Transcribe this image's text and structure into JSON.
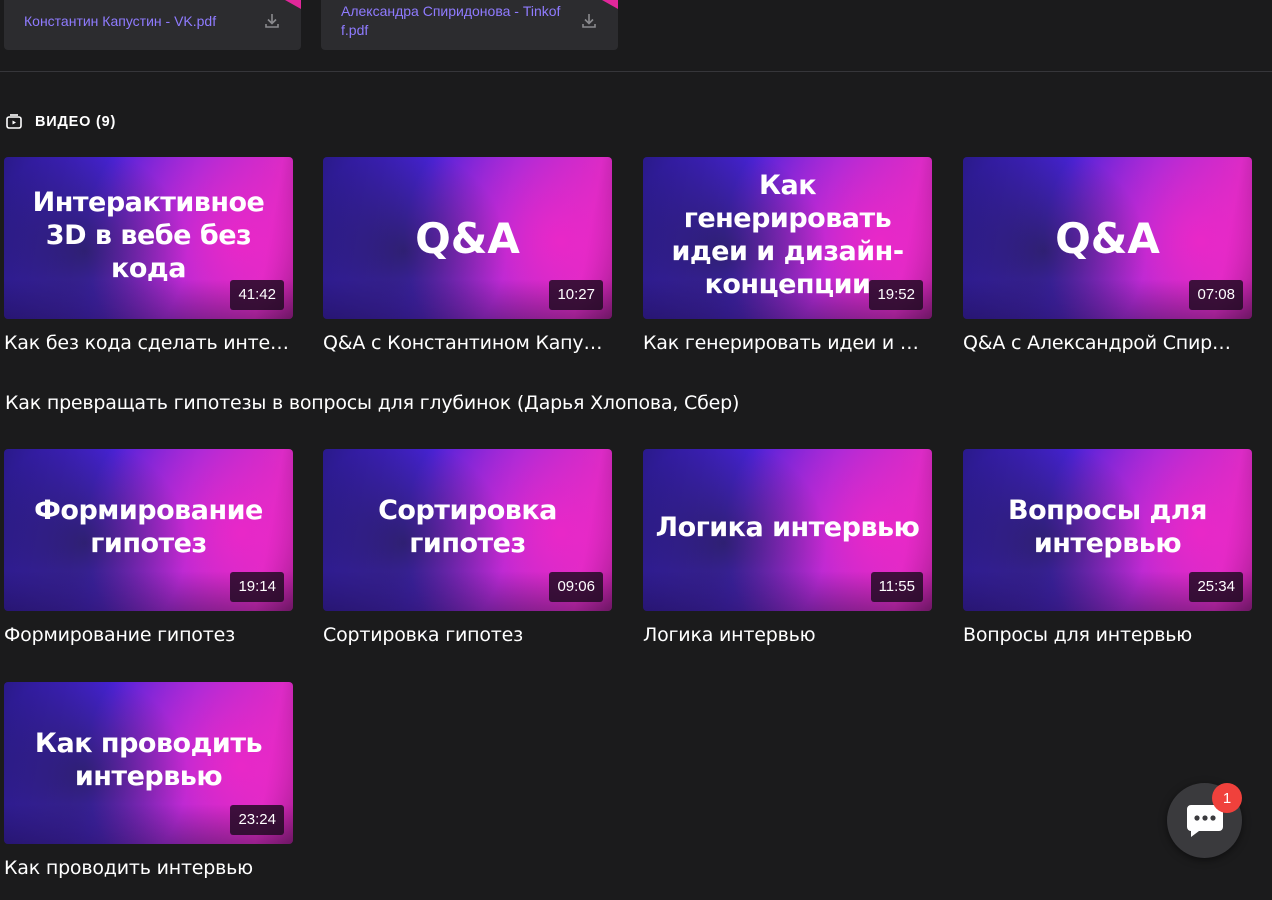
{
  "files": [
    {
      "name": "Константин Капустин - VK.pdf",
      "icon": "download-icon"
    },
    {
      "name": "Александра Спиридонова - Tinkoff.pdf",
      "icon": "download-icon"
    }
  ],
  "section": {
    "title": "ВИДЕО (9)",
    "icon": "video-icon"
  },
  "videos": [
    {
      "thumb": "Интерактивное 3D в вебе без кода",
      "duration": "41:42",
      "title": "Как без кода сделать инте…"
    },
    {
      "thumb": "Q&A",
      "duration": "10:27",
      "title": "Q&A с Константином Капу…"
    },
    {
      "thumb": "Как генерировать идеи и дизайн-концепции",
      "duration": "19:52",
      "title": "Как генерировать идеи и …"
    },
    {
      "thumb": "Q&A",
      "duration": "07:08",
      "title": "Q&A с Александрой Спир…"
    },
    {
      "thumb": "Формирование гипотез",
      "duration": "19:14",
      "title": "Формирование гипотез"
    },
    {
      "thumb": "Сортировка гипотез",
      "duration": "09:06",
      "title": "Сортировка гипотез"
    },
    {
      "thumb": "Логика интервью",
      "duration": "11:55",
      "title": "Логика интервью"
    },
    {
      "thumb": "Вопросы для интервью",
      "duration": "25:34",
      "title": "Вопросы для интервью"
    },
    {
      "thumb": "Как проводить интервью",
      "duration": "23:24",
      "title": "Как проводить интервью"
    }
  ],
  "text_item": "Как превращать гипотезы в вопросы для глубинок (Дарья Хлопова, Сбер)",
  "chat": {
    "badge": "1",
    "icon": "chat-icon"
  },
  "colors": {
    "background": "#1b1b1c",
    "file_link": "#8f7bff",
    "accent_pink": "#e0279a",
    "badge": "#f0413c"
  }
}
